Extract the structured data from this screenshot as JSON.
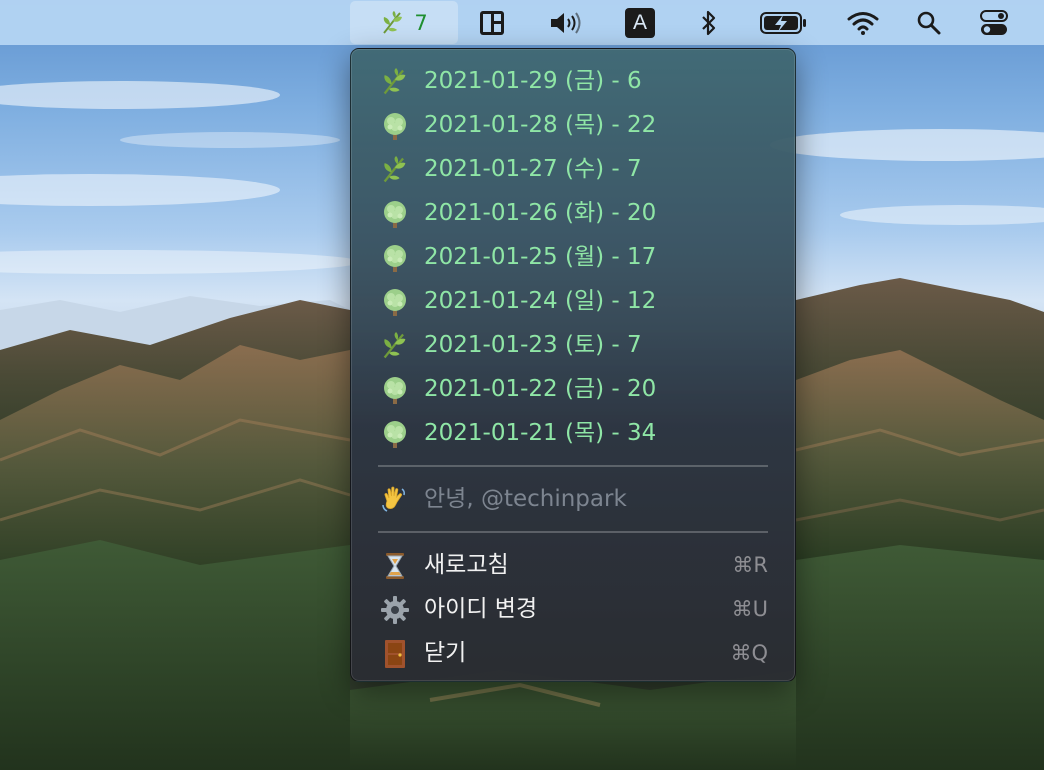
{
  "menubar": {
    "app_count": "7",
    "app_icon": "herb-icon",
    "keyboard_input_letter": "A",
    "icons": [
      "layout-icon",
      "volume-icon",
      "input-source-icon",
      "bluetooth-icon",
      "battery-charging-icon",
      "wifi-icon",
      "search-icon",
      "control-center-icon"
    ]
  },
  "menu": {
    "days": [
      {
        "label": "2021-01-29 (금) - 6",
        "icon": "herb-icon"
      },
      {
        "label": "2021-01-28 (목) - 22",
        "icon": "tree-icon"
      },
      {
        "label": "2021-01-27 (수) - 7",
        "icon": "herb-icon"
      },
      {
        "label": "2021-01-26 (화) - 20",
        "icon": "tree-icon"
      },
      {
        "label": "2021-01-25 (월) - 17",
        "icon": "tree-icon"
      },
      {
        "label": "2021-01-24 (일) - 12",
        "icon": "tree-icon"
      },
      {
        "label": "2021-01-23 (토) - 7",
        "icon": "herb-icon"
      },
      {
        "label": "2021-01-22 (금) - 20",
        "icon": "tree-icon"
      },
      {
        "label": "2021-01-21 (목) - 34",
        "icon": "tree-icon"
      }
    ],
    "greeting": "안녕, @techinpark",
    "actions": [
      {
        "label": "새로고침",
        "shortcut": "⌘R",
        "icon": "hourglass-icon"
      },
      {
        "label": "아이디 변경",
        "shortcut": "⌘U",
        "icon": "gear-icon"
      },
      {
        "label": "닫기",
        "shortcut": "⌘Q",
        "icon": "door-icon"
      }
    ]
  },
  "colors": {
    "day_text": "#8fe6a6",
    "menubar_bg": "#b6d6f4",
    "count_text": "#1f8f2f"
  }
}
